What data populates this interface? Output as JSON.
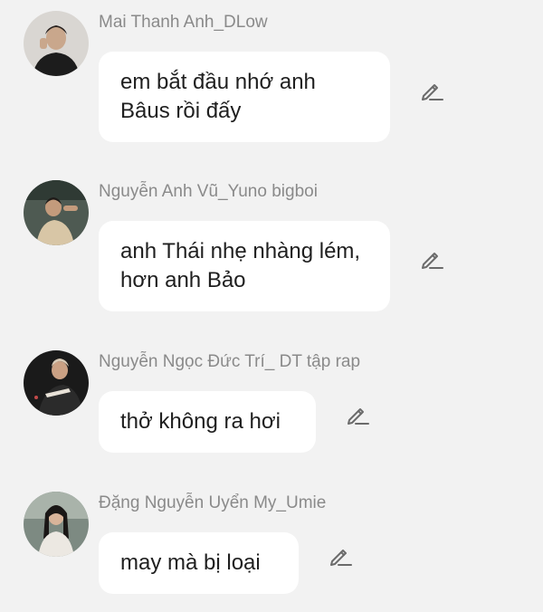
{
  "comments": [
    {
      "author": "Mai Thanh Anh_DLow",
      "text": "em bắt đầu nhớ anh Bâus rồi đấy",
      "avatar": "profile-photo"
    },
    {
      "author": "Nguyễn Anh Vũ_Yuno bigboi",
      "text": "anh Thái nhẹ nhàng lém, hơn anh Bảo",
      "avatar": "profile-photo"
    },
    {
      "author": "Nguyễn Ngọc Đức Trí_ DT tập rap",
      "text": "thở không ra hơi",
      "avatar": "profile-photo"
    },
    {
      "author": "Đặng Nguyễn Uyển My_Umie",
      "text": "may mà bị loại",
      "avatar": "profile-photo"
    }
  ],
  "icons": {
    "edit": "pencil-icon"
  },
  "colors": {
    "background": "#f2f2f2",
    "bubble": "#ffffff",
    "author": "#8a8a8a",
    "text": "#1f1f1f",
    "icon": "#6b6b6b"
  }
}
